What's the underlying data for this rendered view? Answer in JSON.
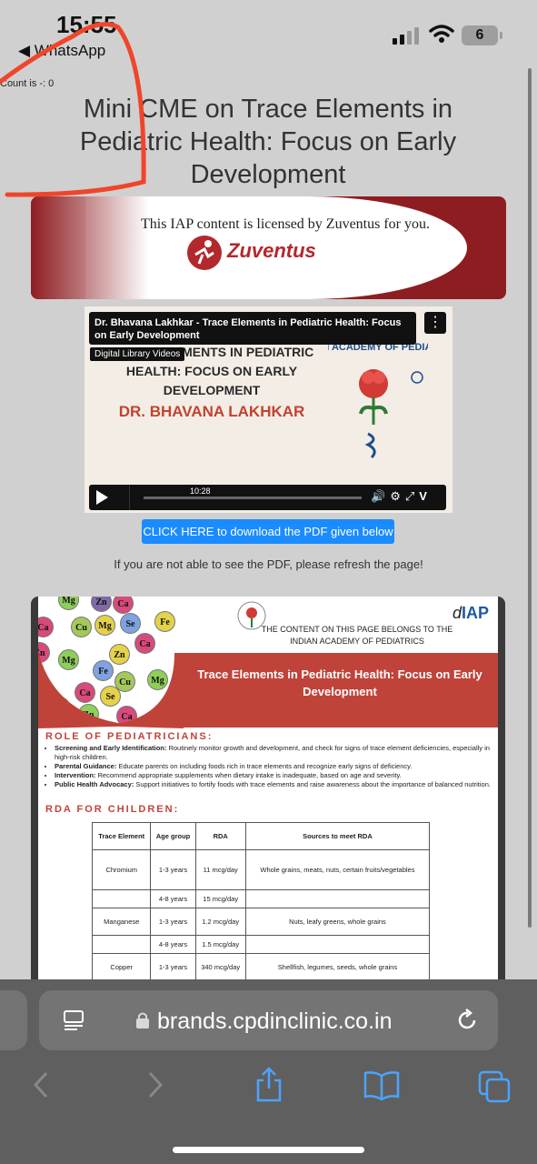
{
  "status_bar": {
    "time": "15:55",
    "back_app": "WhatsApp",
    "battery": "6"
  },
  "page": {
    "count_text": "Count is -: 0",
    "title": "Mini CME on Trace Elements in Pediatric Health: Focus on Early Development",
    "download_button": "CLICK HERE to download the PDF given below",
    "refresh_note": "If you are not able to see the PDF, please refresh the page!"
  },
  "banner": {
    "text": "This IAP content is licensed by Zuventus for you.",
    "brand": "Zuventus"
  },
  "video": {
    "title": "Dr. Bhavana Lakhkar - Trace Elements in Pediatric Health: Focus on Early  Development",
    "badge": "Digital Library Videos",
    "heading": "TRACE ELEMENTS IN PEDIATRIC HEALTH: FOCUS ON EARLY DEVELOPMENT",
    "speaker": "DR. BHAVANA LAKHKAR",
    "logo_text": "INDIAN ACADEMY OF PEDIATRICS",
    "duration": "10:28"
  },
  "pdf": {
    "iap_logo": "IAP",
    "belongs": "THE CONTENT ON THIS PAGE BELONGS TO THE INDIAN ACADEMY OF PEDIATRICS",
    "band_title": "Trace Elements in Pediatric Health: Focus on Early Development",
    "role_heading": "ROLE OF PEDIATRICIANS:",
    "bullets": [
      {
        "lead": "Screening and Early Identification:",
        "text": " Routinely monitor growth and development, and check for signs of trace element deficiencies, especially in high-risk children."
      },
      {
        "lead": "Parental Guidance:",
        "text": " Educate parents on including foods rich in trace elements and recognize early signs of deficiency."
      },
      {
        "lead": "Intervention:",
        "text": " Recommend appropriate supplements when dietary intake is inadequate, based on age and severity."
      },
      {
        "lead": "Public Health Advocacy:",
        "text": " Support initiatives to fortify foods with trace elements and raise awareness about the importance of balanced nutrition."
      }
    ],
    "rda_heading": "RDA FOR CHILDREN:",
    "table_headers": [
      "Trace Element",
      "Age group",
      "RDA",
      "Sources to meet RDA"
    ],
    "table_rows": [
      [
        "Chromium",
        "1-3 years",
        "11 mcg/day",
        "Whole grains, meats, nuts, certain fruits/vegetables"
      ],
      [
        "",
        "4-8 years",
        "15 mcg/day",
        ""
      ],
      [
        "Manganese",
        "1-3 years",
        "1.2 mcg/day",
        "Nuts, leafy greens, whole grains"
      ],
      [
        "",
        "4-8 years",
        "1.5 mcg/day",
        ""
      ],
      [
        "Copper",
        "1-3 years",
        "340 mcg/day",
        "Shellfish, legumes, seeds, whole grains"
      ]
    ],
    "elements": [
      "Mg",
      "Zn",
      "Ca",
      "Ca",
      "Cu",
      "Mg",
      "Se",
      "Fe",
      "Ca",
      "Zn",
      "Mg",
      "Fe",
      "Zn",
      "Ca",
      "Cu",
      "Mg",
      "Se",
      "Zn",
      "Ca",
      "Cr"
    ]
  },
  "browser": {
    "url": "brands.cpdinclinic.co.in"
  },
  "colors": {
    "accent_red": "#c0433a",
    "button_blue": "#1a8cff",
    "zuventus_red": "#b3282d",
    "iap_blue": "#1d5b9e"
  }
}
